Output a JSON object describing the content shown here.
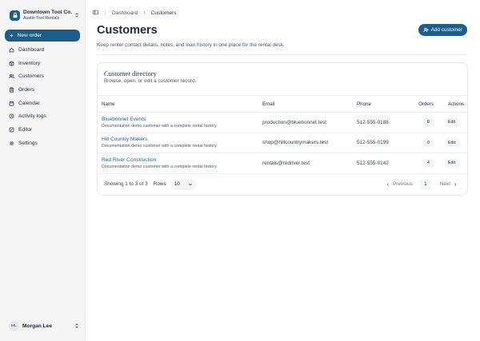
{
  "sidebar": {
    "org_name": "Downtown Tool Co.",
    "org_sub": "Austin Tool Rentals",
    "new_order_label": "New order",
    "items": [
      {
        "label": "Dashboard",
        "icon": "home-icon"
      },
      {
        "label": "Inventory",
        "icon": "box-icon"
      },
      {
        "label": "Customers",
        "icon": "users-icon"
      },
      {
        "label": "Orders",
        "icon": "clipboard-icon"
      },
      {
        "label": "Calendar",
        "icon": "calendar-icon"
      },
      {
        "label": "Activity logs",
        "icon": "history-icon"
      },
      {
        "label": "Editor",
        "icon": "pencil-icon"
      },
      {
        "label": "Settings",
        "icon": "gear-icon"
      }
    ],
    "user": {
      "initials": "ML",
      "name": "Morgan Lee"
    }
  },
  "breadcrumb": {
    "root": "Dashboard",
    "current": "Customers"
  },
  "header": {
    "title": "Customers",
    "subtitle": "Keep renter contact details, notes, and loan history in one place for the rental desk.",
    "add_label": "Add customer"
  },
  "directory": {
    "title": "Customer directory",
    "subtitle": "Browse, open, or edit a customer record.",
    "columns": {
      "name": "Name",
      "email": "Email",
      "phone": "Phone",
      "orders": "Orders",
      "actions": "Actions"
    },
    "rows": [
      {
        "name": "Bluebonnet Events",
        "note": "Documentation demo customer with a complete rental history.",
        "email": "production@bluebonnet.test",
        "phone": "512-555-0188",
        "orders": "0",
        "action": "Edit"
      },
      {
        "name": "Hill Country Makers",
        "note": "Documentation demo customer with a complete rental history.",
        "email": "shop@hillcountrymakers.test",
        "phone": "512-555-0199",
        "orders": "0",
        "action": "Edit"
      },
      {
        "name": "Red River Construction",
        "note": "Documentation demo customer with a complete rental history.",
        "email": "rentals@redriver.test",
        "phone": "512-555-0142",
        "orders": "4",
        "action": "Edit"
      }
    ],
    "footer": {
      "showing": "Showing 1 to 3 of 3",
      "rows_label": "Rows",
      "rows_value": "10",
      "previous": "Previous",
      "page": "1",
      "next": "Next"
    }
  },
  "colors": {
    "accent": "#1d5d8a"
  }
}
